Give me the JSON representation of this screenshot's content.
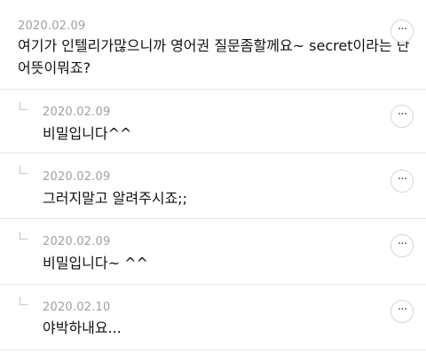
{
  "comments": [
    {
      "date": "2020.02.09",
      "text_line1": "여기가 인텔리가많으니까 영어권 질문좀할께요~ secret이라는 단",
      "text_line2": "어뜻이뭐죠?"
    },
    {
      "date": "2020.02.09",
      "text": "비밀입니다^^"
    },
    {
      "date": "2020.02.09",
      "text": "그러지말고 알려주시죠;;"
    },
    {
      "date": "2020.02.09",
      "text": "비밀입니다~ ^^"
    },
    {
      "date": "2020.02.10",
      "text": "야박하내요..."
    }
  ],
  "more_button": {
    "icon": "more-dots-icon",
    "glyph": "···"
  },
  "reply_icon": "reply-indent-icon"
}
